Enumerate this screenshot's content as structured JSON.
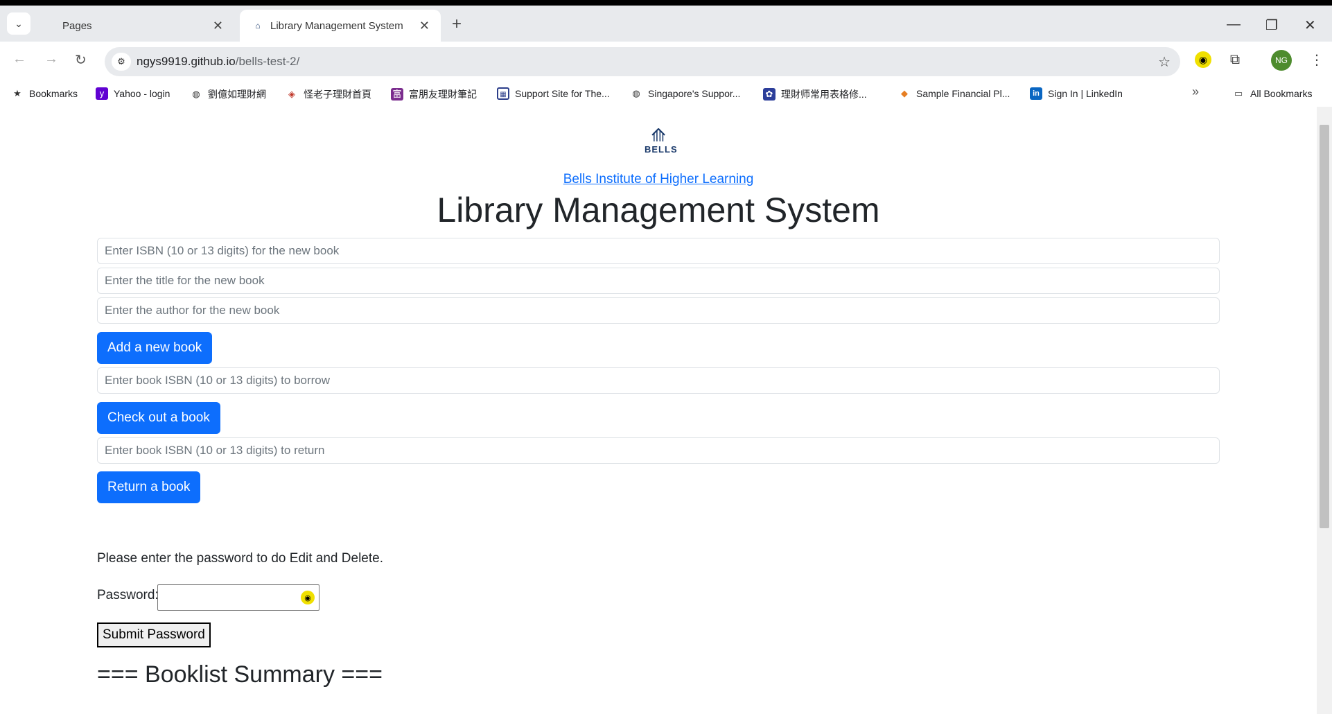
{
  "browser": {
    "tabs": [
      {
        "label": "Pages",
        "close": "✕"
      },
      {
        "label": "Library Management System",
        "close": "✕"
      }
    ],
    "new_tab": "+",
    "url_domain": "ngys9919.github.io",
    "url_path": "/bells-test-2/",
    "avatar_initials": "NG",
    "bookmarks": [
      {
        "label": "Bookmarks",
        "icon": "star-icon"
      },
      {
        "label": "Yahoo - login",
        "icon": "yahoo-icon"
      },
      {
        "label": "劉億如理財網",
        "icon": "globe-icon"
      },
      {
        "label": "怪老子理財首頁",
        "icon": "logo-icon"
      },
      {
        "label": "富朋友理財筆記",
        "icon": "logo-icon"
      },
      {
        "label": "Support Site for The...",
        "icon": "grid-icon"
      },
      {
        "label": "Singapore's Suppor...",
        "icon": "globe-icon"
      },
      {
        "label": "理財师常用表格修...",
        "icon": "paw-icon"
      },
      {
        "label": "Sample Financial Pl...",
        "icon": "logo-icon"
      },
      {
        "label": "Sign In | LinkedIn",
        "icon": "linkedin-icon"
      }
    ],
    "all_bookmarks": "All Bookmarks",
    "more_bookmarks": "»"
  },
  "page": {
    "logo_word": "BELLS",
    "institution_link": "Bells Institute of Higher Learning",
    "title": "Library Management System",
    "isbn_placeholder": "Enter ISBN (10 or 13 digits) for the new book",
    "title_placeholder": "Enter the title for the new book",
    "author_placeholder": "Enter the author for the new book",
    "add_button": "Add a new book",
    "borrow_placeholder": "Enter book ISBN (10 or 13 digits) to borrow",
    "checkout_button": "Check out a book",
    "return_placeholder": "Enter book ISBN (10 or 13 digits) to return",
    "return_button": "Return a book",
    "password_prompt": "Please enter the password to do Edit and Delete.",
    "password_label": "Password:",
    "submit_button": "Submit Password",
    "booklist_heading": "=== Booklist Summary ==="
  },
  "colors": {
    "primary_button": "#0d6efd",
    "link": "#0d6efd",
    "logo": "#1b3a6b"
  }
}
